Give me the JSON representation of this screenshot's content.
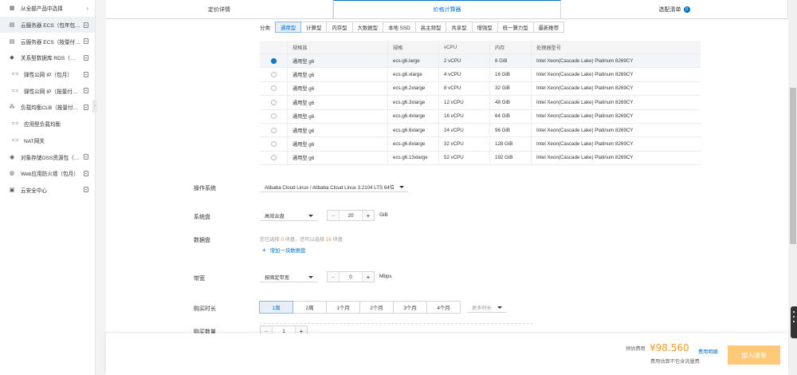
{
  "sidebar": {
    "items": [
      {
        "icon": "grid-icon",
        "label": "从全部产品中选择",
        "trail": "arrow"
      },
      {
        "icon": "server-icon",
        "label": "云服务器 ECS（包年包月）",
        "trail": "doc"
      },
      {
        "icon": "server-icon",
        "label": "云服务器 ECS（按量付费）",
        "trail": "doc"
      },
      {
        "icon": "database-icon",
        "label": "关系型数据库 RDS（包年包月）",
        "trail": "doc"
      },
      {
        "icon": "link-icon",
        "label": "弹性公网 IP（包月）",
        "trail": "doc",
        "sub": true
      },
      {
        "icon": "link-icon",
        "label": "弹性公网 IP（按量付费）",
        "trail": "doc",
        "sub": true
      },
      {
        "icon": "network-icon",
        "label": "负载均衡CLB（按量付费）",
        "trail": "doc"
      },
      {
        "icon": "link-icon",
        "label": "应用型负载均衡",
        "trail": "none",
        "sub": true
      },
      {
        "icon": "link-icon",
        "label": "NAT网关",
        "trail": "none",
        "sub": true
      },
      {
        "icon": "storage-icon",
        "label": "对象存储OSS资源包（包年）",
        "trail": "doc"
      },
      {
        "icon": "globe-icon",
        "label": "Web应用防火墙（包月）",
        "trail": "doc"
      },
      {
        "icon": "shield-icon",
        "label": "云安全中心",
        "trail": "doc"
      }
    ]
  },
  "tabs": [
    {
      "label": "定价详情"
    },
    {
      "label": "价格计算器"
    },
    {
      "label": "选配清单",
      "badge": "0"
    }
  ],
  "category": {
    "label": "分类",
    "options": [
      "通用型",
      "计算型",
      "内存型",
      "大数据型",
      "本地 SSD",
      "高主频型",
      "共享型",
      "增强型",
      "统一算力型",
      "最新推荐"
    ],
    "selected_index": 0
  },
  "table": {
    "headers": [
      "规格族",
      "规格",
      "vCPU",
      "内存",
      "处理器型号"
    ],
    "selected_index": 0,
    "rows": [
      [
        "通用型 g6",
        "ecs.g6.large",
        "2 vCPU",
        "8 GiB",
        "Intel Xeon(Cascade Lake) Platinum 8269CY"
      ],
      [
        "通用型 g6",
        "ecs.g6.xlarge",
        "4 vCPU",
        "16 GiB",
        "Intel Xeon(Cascade Lake) Platinum 8269CY"
      ],
      [
        "通用型 g6",
        "ecs.g6.2xlarge",
        "8 vCPU",
        "32 GiB",
        "Intel Xeon(Cascade Lake) Platinum 8269CY"
      ],
      [
        "通用型 g6",
        "ecs.g6.3xlarge",
        "12 vCPU",
        "48 GiB",
        "Intel Xeon(Cascade Lake) Platinum 8269CY"
      ],
      [
        "通用型 g6",
        "ecs.g6.4xlarge",
        "16 vCPU",
        "64 GiB",
        "Intel Xeon(Cascade Lake) Platinum 8269CY"
      ],
      [
        "通用型 g6",
        "ecs.g6.6xlarge",
        "24 vCPU",
        "96 GiB",
        "Intel Xeon(Cascade Lake) Platinum 8269CY"
      ],
      [
        "通用型 g6",
        "ecs.g6.8xlarge",
        "32 vCPU",
        "128 GiB",
        "Intel Xeon(Cascade Lake) Platinum 8269CY"
      ],
      [
        "通用型 g6",
        "ecs.g6.13xlarge",
        "52 vCPU",
        "192 GiB",
        "Intel Xeon(Cascade Lake) Platinum 8269CY"
      ]
    ]
  },
  "os": {
    "label": "操作系统",
    "value": "Alibaba Cloud Linux / Alibaba Cloud Linux 3.2104 LTS 64位"
  },
  "system_disk": {
    "label": "系统盘",
    "type": "高效云盘",
    "size": "20",
    "unit": "GiB"
  },
  "data_disk": {
    "label": "数据盘",
    "note_prefix": "您已选择",
    "selected_count": "0",
    "note_mid": "块盘，还可以选择",
    "remaining_count": "16",
    "note_suffix": "块盘",
    "add_label": "增加一块数据盘"
  },
  "bandwidth": {
    "label": "带宽",
    "type": "按固定带宽",
    "value": "0",
    "unit": "Mbps"
  },
  "duration": {
    "label": "购买时长",
    "options": [
      "1周",
      "2周",
      "1个月",
      "2个月",
      "3个月",
      "4个月"
    ],
    "selected_index": 0,
    "more": "更多时长"
  },
  "quantity": {
    "label": "购买数量",
    "value": "1"
  },
  "summary": {
    "fee_label": "预估费用",
    "price": "¥98.560",
    "detail_link": "费用明细",
    "sub_note": "费用估算不包含流量费",
    "add_to_cart": "加入清单"
  },
  "colors": {
    "accent": "#0070cc",
    "price": "#f59a23",
    "cart_button": "#ffc979"
  }
}
